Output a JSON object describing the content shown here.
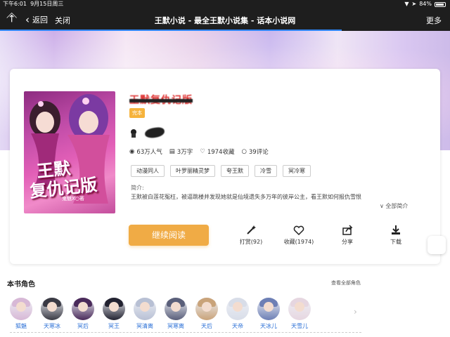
{
  "statusbar": {
    "time": "下午6:01",
    "date": "9月15日周三",
    "battery": "84%"
  },
  "nav": {
    "back_label": "返回",
    "close_label": "关闭",
    "title": "王默小说 - 最全王默小说集 - 话本小说网",
    "more_label": "更多",
    "progress": 0.76
  },
  "book": {
    "title": "王默复仇记版",
    "status_badge": "完本",
    "cover_text_1": "王默",
    "cover_text_2": "复仇记版",
    "cover_text_3": "鬼魅X○著",
    "stats": {
      "popularity": "63万人气",
      "words": "3万字",
      "favorites": "1974收藏",
      "comments": "39评论"
    },
    "tags": [
      "动漫同人",
      "叶罗丽精灵梦",
      "夸王默",
      "冷雪",
      "冥冷寒"
    ],
    "intro_label": "简介:",
    "intro_text": "王默被白莲花冤枉，被逼跳楼并发现她就是仙境遗失多万年的彼岸公主，看王默如何报仇雪恨",
    "expand_label": "全部简介"
  },
  "actions": {
    "read_label": "继续阅读",
    "reward_label": "打赏(92)",
    "favorite_label": "收藏(1974)",
    "share_label": "分享",
    "download_label": "下载"
  },
  "roles": {
    "title": "本书角色",
    "see_all": "查看全部角色",
    "items": [
      {
        "name": "狐魅",
        "color": "#d7b8d6"
      },
      {
        "name": "天寒冰",
        "color": "#3a3a44"
      },
      {
        "name": "冥后",
        "color": "#4a2a5a"
      },
      {
        "name": "冥王",
        "color": "#222230"
      },
      {
        "name": "冥清离",
        "color": "#b8c0d4"
      },
      {
        "name": "冥寒离",
        "color": "#5a5f7a"
      },
      {
        "name": "天后",
        "color": "#c9a37a"
      },
      {
        "name": "天帝",
        "color": "#d8dde8"
      },
      {
        "name": "天冰儿",
        "color": "#6d7fb5"
      },
      {
        "name": "天雪儿",
        "color": "#e6d6e0"
      }
    ]
  }
}
